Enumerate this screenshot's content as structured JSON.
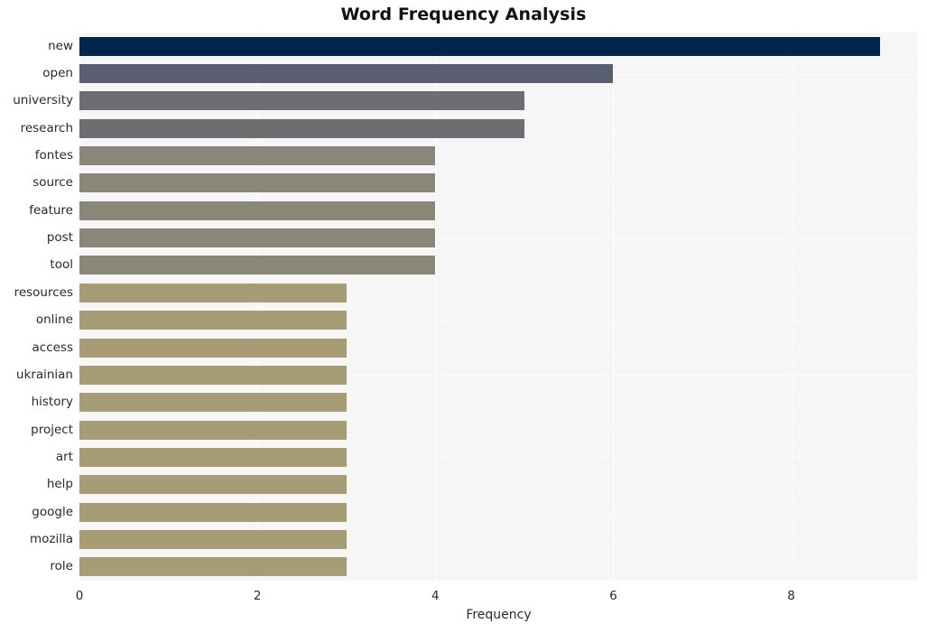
{
  "chart_data": {
    "type": "bar",
    "orientation": "horizontal",
    "title": "Word Frequency Analysis",
    "xlabel": "Frequency",
    "ylabel": "",
    "xlim": [
      0,
      9.425
    ],
    "xticks": [
      0,
      2,
      4,
      6,
      8
    ],
    "xtick_labels": [
      "0",
      "2",
      "4",
      "6",
      "8"
    ],
    "grid": true,
    "legend": "none",
    "categories": [
      "new",
      "open",
      "university",
      "research",
      "fontes",
      "source",
      "feature",
      "post",
      "tool",
      "resources",
      "online",
      "access",
      "ukrainian",
      "history",
      "project",
      "art",
      "help",
      "google",
      "mozilla",
      "role"
    ],
    "values": [
      9,
      6,
      5,
      5,
      4,
      4,
      4,
      4,
      4,
      3,
      3,
      3,
      3,
      3,
      3,
      3,
      3,
      3,
      3,
      3
    ],
    "bar_colors": [
      "#03244d",
      "#595e70",
      "#6d6e71",
      "#6d6e71",
      "#8a8678",
      "#8a8678",
      "#8a8678",
      "#8a8678",
      "#8a8678",
      "#a69c75",
      "#a69c75",
      "#a69c75",
      "#a69c75",
      "#a69c75",
      "#a69c75",
      "#a69c75",
      "#a69c75",
      "#a69c75",
      "#a69c75",
      "#a69c75"
    ],
    "plot_background": "#f6f6f7",
    "grid_color": "#ffffff",
    "figure_background": "#ffffff",
    "text_color": "#2a2a2a",
    "title_color": "#121212"
  }
}
